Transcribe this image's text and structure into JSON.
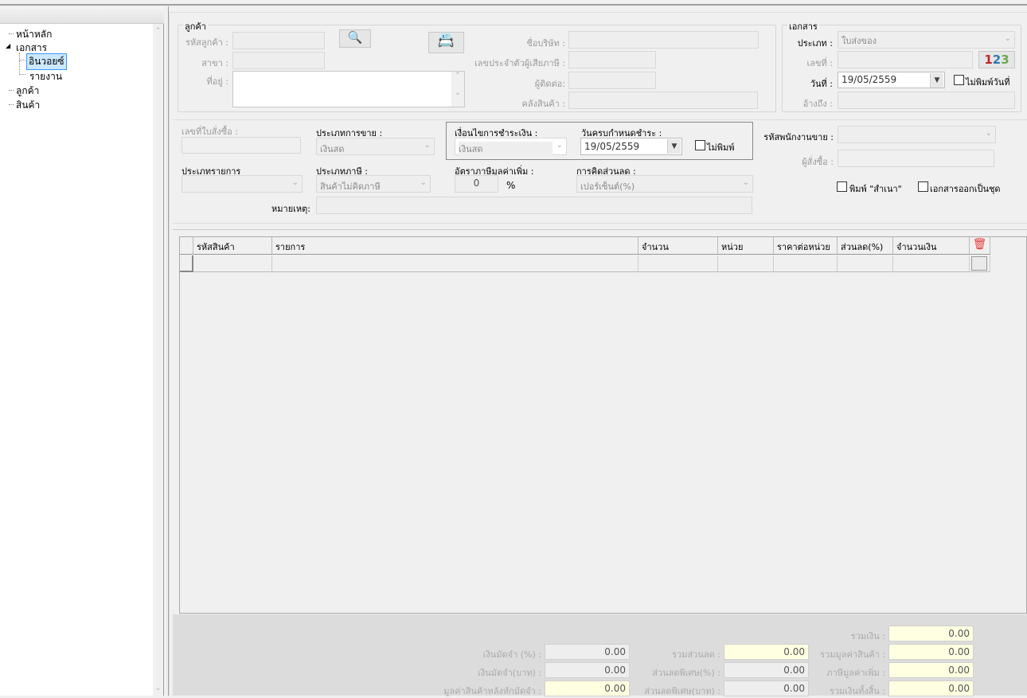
{
  "tree": {
    "items": [
      {
        "label": "หน้าหลัก"
      },
      {
        "label": "เอกสาร"
      },
      {
        "label": "อินวอยซ์"
      },
      {
        "label": "รายงาน"
      },
      {
        "label": "ลูกค้า"
      },
      {
        "label": "สินค้า"
      }
    ]
  },
  "customer": {
    "legend": "ลูกค้า",
    "code_label": "รหัสลูกค้า :",
    "branch_label": "สาขา :",
    "address_label": "ที่อยู่ :",
    "company_label": "ชื่อบริษัท :",
    "taxid_label": "เลขประจำตัวผู้เสียภาษี :",
    "contact_label": "ผู้ติดต่อ:",
    "warehouse_label": "คลังสินค้า :"
  },
  "document": {
    "legend": "เอกสาร",
    "type_label": "ประเภท :",
    "type_value": "ใบส่งของ",
    "number_label": "เลขที่ :",
    "number_button": "123",
    "date_label": "วันที่ :",
    "date_value": "19/05/2559",
    "no_print_date_label": "ไม่พิมพ์วันที่",
    "reference_label": "อ้างถึง :"
  },
  "order": {
    "po_label": "เลขที่ใบสั่งซื้อ :",
    "sale_type_label": "ประเภทการขาย :",
    "sale_type_value": "เงินสด",
    "payment_terms_label": "เงื่อนไขการชำระเงิน :",
    "payment_terms_value": "เงินสด",
    "due_date_label": "วันครบกำหนดชำระ :",
    "due_date_value": "19/05/2559",
    "no_print_label": "ไม่พิมพ์",
    "item_type_label": "ประเภทรายการ",
    "tax_type_label": "ประเภทภาษี :",
    "tax_type_value": "สินค้าไม่คิดภาษี",
    "vat_rate_label": "อัตราภาษีมูลค่าเพิ่ม :",
    "vat_rate_value": "0",
    "vat_rate_unit": "%",
    "discount_type_label": "การคิดส่วนลด :",
    "discount_type_value": "เปอร์เซ็นต์(%)",
    "note_label": "หมายเหตุ:",
    "salesperson_label": "รหัสพนักงานขาย :",
    "orderer_label": "ผู้สั่งซื้อ :",
    "print_copy_label": "พิมพ์ \"สำเนา\"",
    "doc_set_label": "เอกสารออกเป็นชุด"
  },
  "table": {
    "columns": [
      "รหัสสินค้า",
      "รายการ",
      "จำนวน",
      "หน่วย",
      "ราคาต่อหน่วย",
      "ส่วนลด(%)",
      "จำนวนเงิน"
    ]
  },
  "totals": {
    "subtotal": {
      "label": "รวมเงิน :",
      "value": "0.00"
    },
    "deposit_pct": {
      "label": "เงินมัดจำ (%) :",
      "value": "0.00"
    },
    "total_discount": {
      "label": "รวมส่วนลด :",
      "value": "0.00"
    },
    "goods_value": {
      "label": "รวมมูลค่าสินค้า :",
      "value": "0.00"
    },
    "deposit_baht": {
      "label": "เงินมัดจำ(บาท) :",
      "value": "0.00"
    },
    "special_discount_pct": {
      "label": "ส่วนลดพิเศษ(%) :",
      "value": "0.00"
    },
    "vat": {
      "label": "ภาษีมูลค่าเพิ่ม :",
      "value": "0.00"
    },
    "after_deposit": {
      "label": "มูลค่าสินค้าหลังหักมัดจำ :",
      "value": "0.00"
    },
    "special_discount_baht": {
      "label": "ส่วนลดพิเศษ(บาท) :",
      "value": "0.00"
    },
    "grand_total": {
      "label": "รวมเงินทั้งสิ้น :",
      "value": "0.00"
    }
  }
}
